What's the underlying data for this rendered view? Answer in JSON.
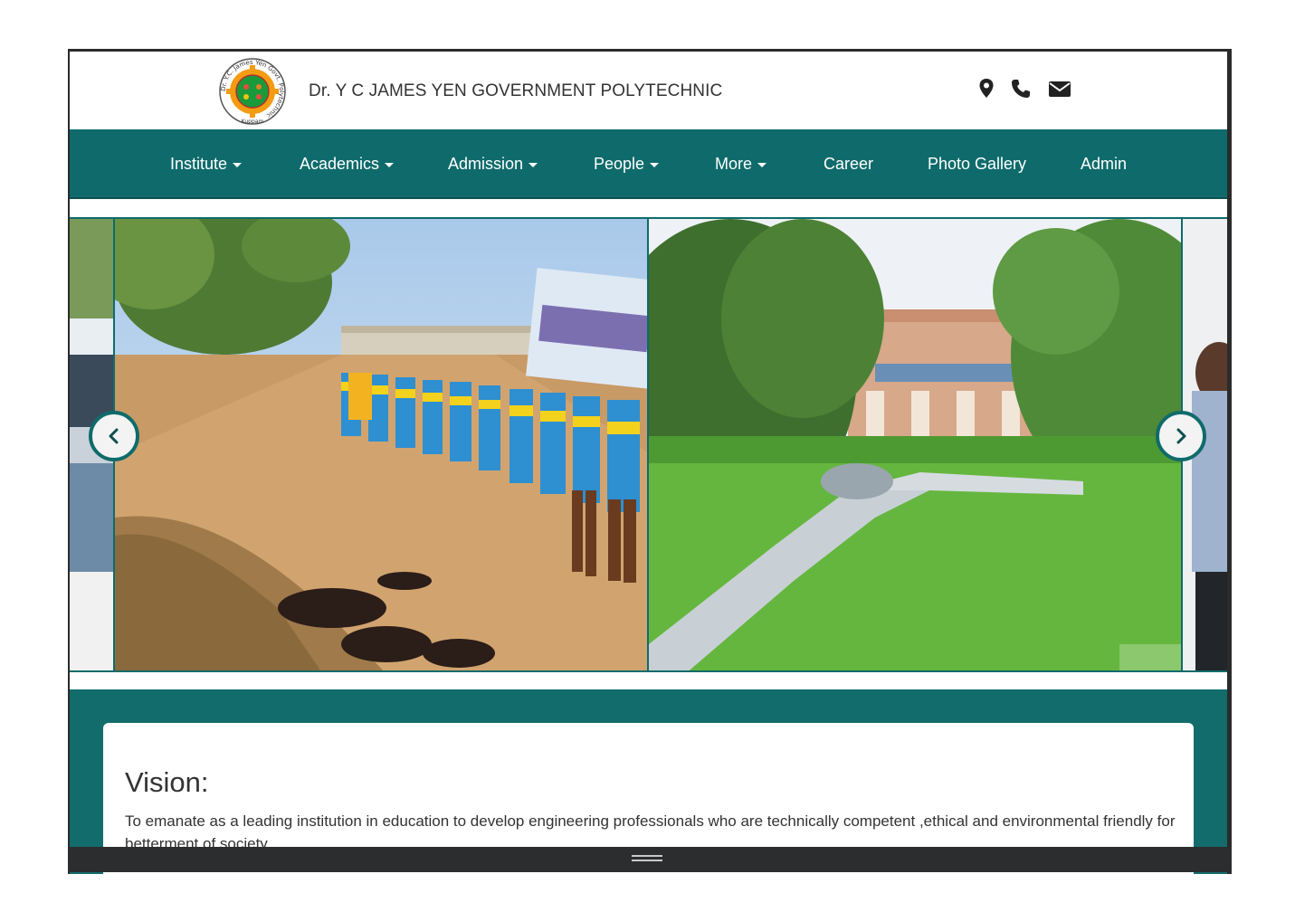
{
  "header": {
    "title": "Dr. Y C JAMES YEN GOVERNMENT POLYTECHNIC",
    "logo": {
      "ring_text": "Dr. Y.C. James Yen Govt. Polytechnic",
      "bottom_text": "Kuppam",
      "icon": "institution-emblem"
    },
    "icons": [
      "map-marker-icon",
      "phone-icon",
      "envelope-icon"
    ]
  },
  "nav": {
    "items": [
      {
        "label": "Institute",
        "dropdown": true
      },
      {
        "label": "Academics",
        "dropdown": true
      },
      {
        "label": "Admission",
        "dropdown": true
      },
      {
        "label": "People",
        "dropdown": true
      },
      {
        "label": "More",
        "dropdown": true
      },
      {
        "label": "Career",
        "dropdown": false
      },
      {
        "label": "Photo Gallery",
        "dropdown": false
      },
      {
        "label": "Admin",
        "dropdown": false
      }
    ]
  },
  "carousel": {
    "slides": [
      "students-sports-march-photo",
      "campus-building-lawn-photo"
    ],
    "prev_icon": "chevron-left-icon",
    "next_icon": "chevron-right-icon"
  },
  "vision": {
    "title": "Vision:",
    "text": "To emanate as a leading institution in education to develop engineering professionals who are technically competent ,ethical and environmental friendly for betterment of society."
  },
  "colors": {
    "navbar": "#0f6b6b",
    "band": "#136c6c",
    "text": "#333333"
  }
}
